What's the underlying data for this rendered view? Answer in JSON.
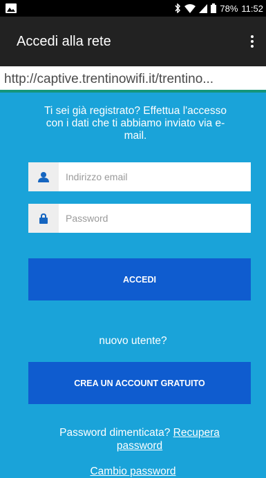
{
  "status_bar": {
    "battery_percent": "78%",
    "time": "11:52"
  },
  "app_bar": {
    "title": "Accedi alla rete"
  },
  "url_bar": {
    "url": "http://captive.trentinowifi.it/trentino..."
  },
  "login": {
    "intro": "Ti sei già registrato? Effettua l'accesso con i dati che ti abbiamo inviato via e-mail.",
    "email_placeholder": "Indirizzo email",
    "email_value": "",
    "password_placeholder": "Password",
    "password_value": "",
    "submit_label": "ACCEDI"
  },
  "register": {
    "prompt": "nuovo utente?",
    "button_label": "CREA UN ACCOUNT GRATUITO"
  },
  "links": {
    "forgot_text": "Password dimenticata?",
    "recover_label": "Recupera password",
    "change_label": "Cambio password"
  },
  "colors": {
    "background": "#1aa3d9",
    "button": "#0f5ccf",
    "icon_blue": "#1565c0",
    "url_underline": "#15957a"
  },
  "icons": {
    "email": "user-icon",
    "password": "lock-icon",
    "menu": "more-vert-icon"
  }
}
